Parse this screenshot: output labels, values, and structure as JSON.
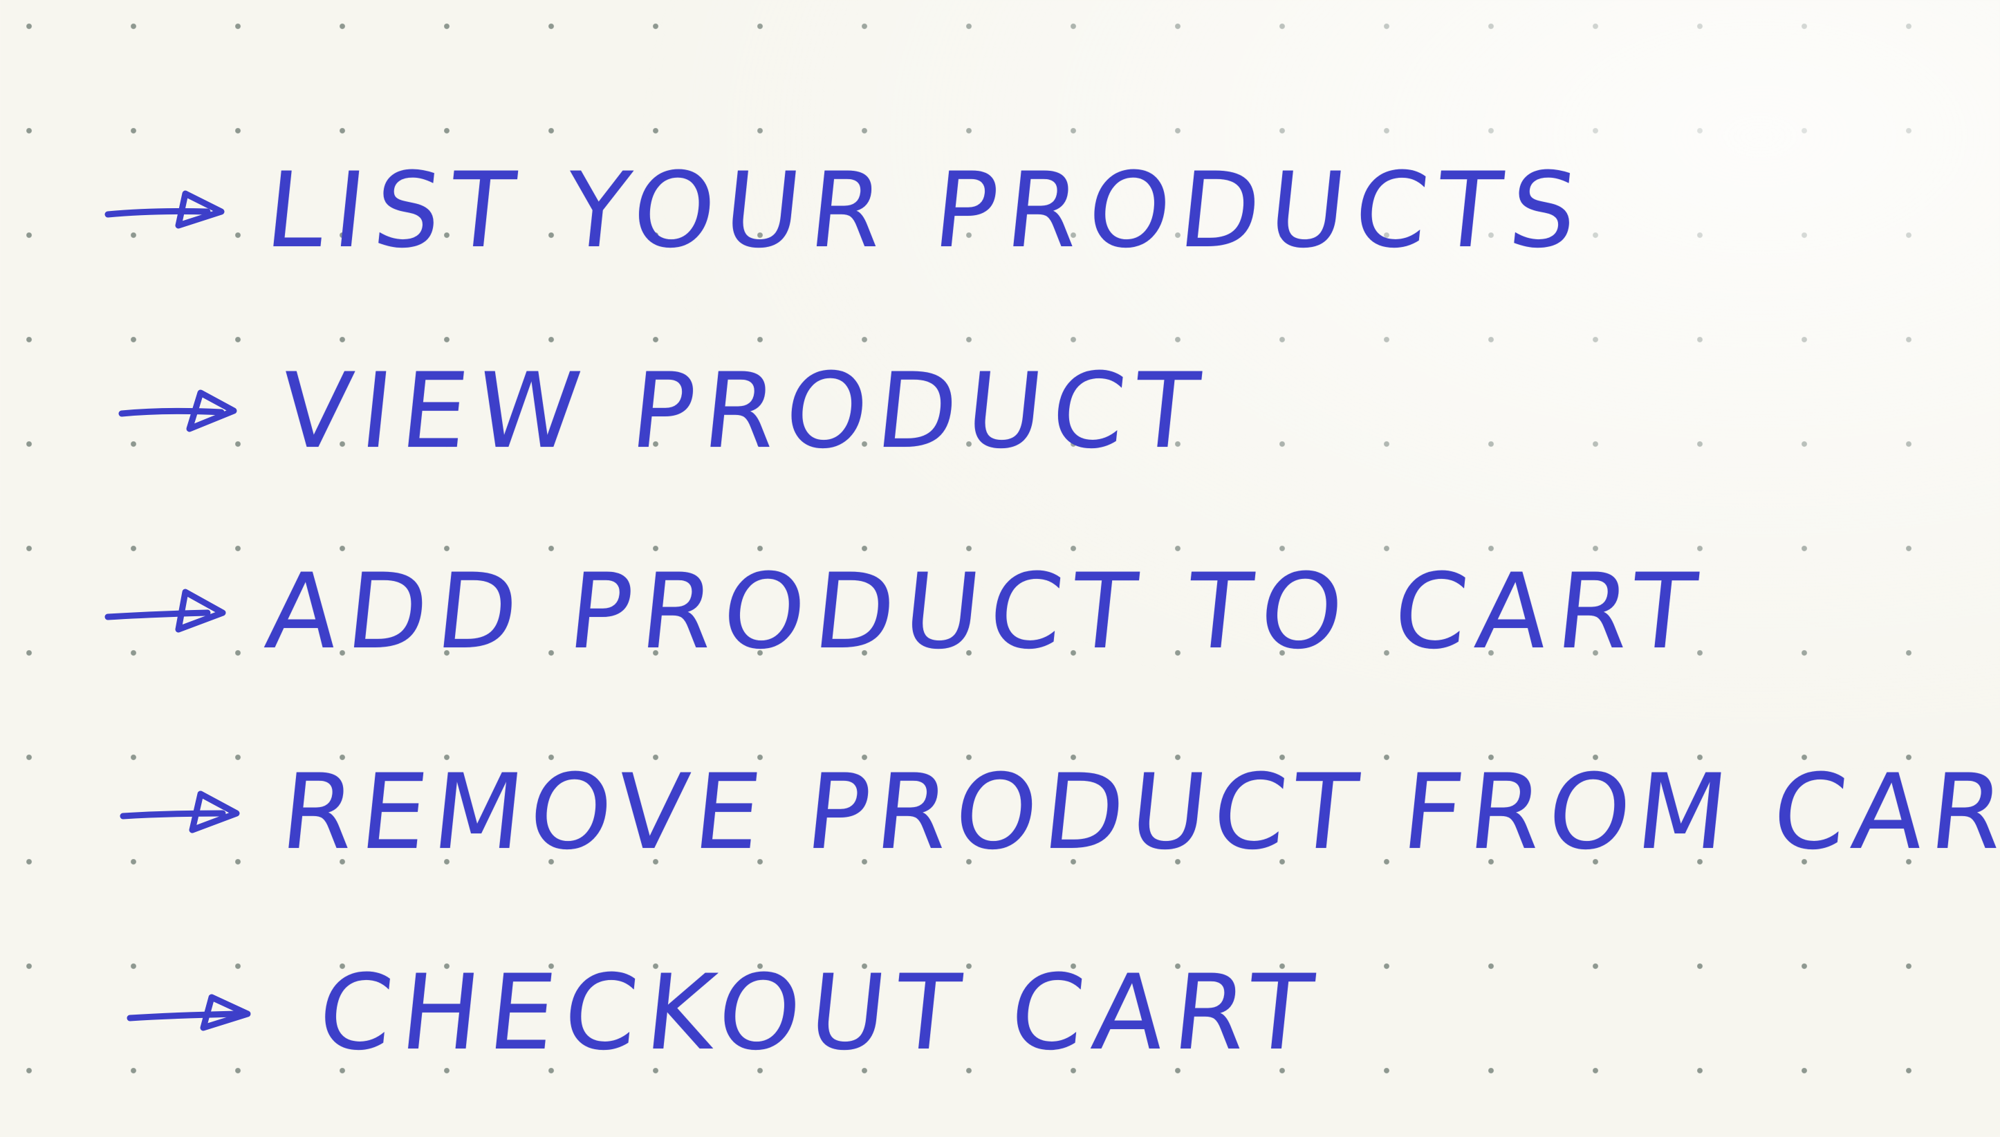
{
  "document": {
    "paper": "dot-grid",
    "ink_color": "#3d3fc9",
    "bullet_icon": "arrow-icon",
    "items": [
      {
        "label": "LIST YOUR PRODUCTS"
      },
      {
        "label": "VIEW PRODUCT"
      },
      {
        "label": "ADD PRODUCT TO CART"
      },
      {
        "label": "REMOVE PRODUCT FROM CART"
      },
      {
        "label": "CHECKOUT CART"
      }
    ]
  }
}
